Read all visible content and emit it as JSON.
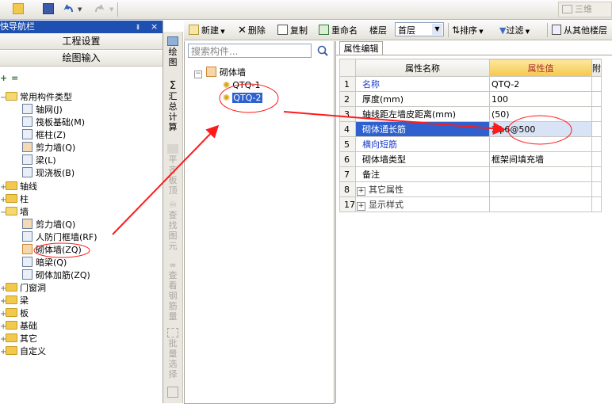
{
  "toolbar": {
    "new_label": "新建",
    "delete_label": "删除",
    "copy_label": "复制",
    "rename_label": "重命名",
    "floor_label": "楼层",
    "floor_value": "首层",
    "sort_label": "排序",
    "filter_label": "过滤",
    "copy_from_other_label": "从其他楼层",
    "view3d_label": "三维"
  },
  "nav": {
    "title": "快导航栏",
    "pin_glyph": "ᵻ",
    "close_glyph": "×",
    "engineering_settings": "工程设置",
    "drawing_input": "绘图输入",
    "tree": {
      "root": "常用构件类型",
      "common_items": [
        "轴网(J)",
        "筏板基础(M)",
        "框柱(Z)",
        "剪力墙(Q)",
        "梁(L)",
        "现浇板(B)"
      ],
      "axis": "轴线",
      "column": "柱",
      "wall": "墙",
      "wall_items": [
        "剪力墙(Q)",
        "人防门框墙(RF)",
        "砌体墙(ZQ)",
        "暗梁(Q)",
        "砌体加筋(ZQ)"
      ],
      "others": [
        "门窗洞",
        "梁",
        "板",
        "基础",
        "其它",
        "自定义"
      ]
    }
  },
  "vtoolbar": {
    "draw": "绘图",
    "summary": "汇总计算",
    "flat_top": "平齐板顶",
    "find": "查找图元",
    "view_rebar": "查看钢筋量",
    "batch_select": "批量选择"
  },
  "complist": {
    "search_placeholder": "搜索构件...",
    "root": "砌体墙",
    "items": [
      "QTQ-1",
      "QTQ-2"
    ]
  },
  "props": {
    "tab": "属性编辑",
    "col_name": "属性名称",
    "col_value": "属性值",
    "col_extra": "附",
    "rows": [
      {
        "idx": "1",
        "name": "名称",
        "value": "QTQ-2"
      },
      {
        "idx": "2",
        "name": "厚度(mm)",
        "value": "100"
      },
      {
        "idx": "3",
        "name": "轴线距左墙皮距离(mm)",
        "value": "(50)"
      },
      {
        "idx": "4",
        "name": "砌体通长筋",
        "value": "2ф6@500"
      },
      {
        "idx": "5",
        "name": "横向短筋",
        "value": ""
      },
      {
        "idx": "6",
        "name": "砌体墙类型",
        "value": "框架间填充墙"
      },
      {
        "idx": "7",
        "name": "备注",
        "value": ""
      },
      {
        "idx": "8",
        "name": "其它属性",
        "value": ""
      },
      {
        "idx": "17",
        "name": "显示样式",
        "value": ""
      }
    ]
  },
  "colors": {
    "nav_title_bg": "#1d50b0",
    "selection_blue": "#2e61cf",
    "value_header": "#f5c84a",
    "annotation_red": "#ff1a1a",
    "link_blue": "#1a3cc9"
  }
}
